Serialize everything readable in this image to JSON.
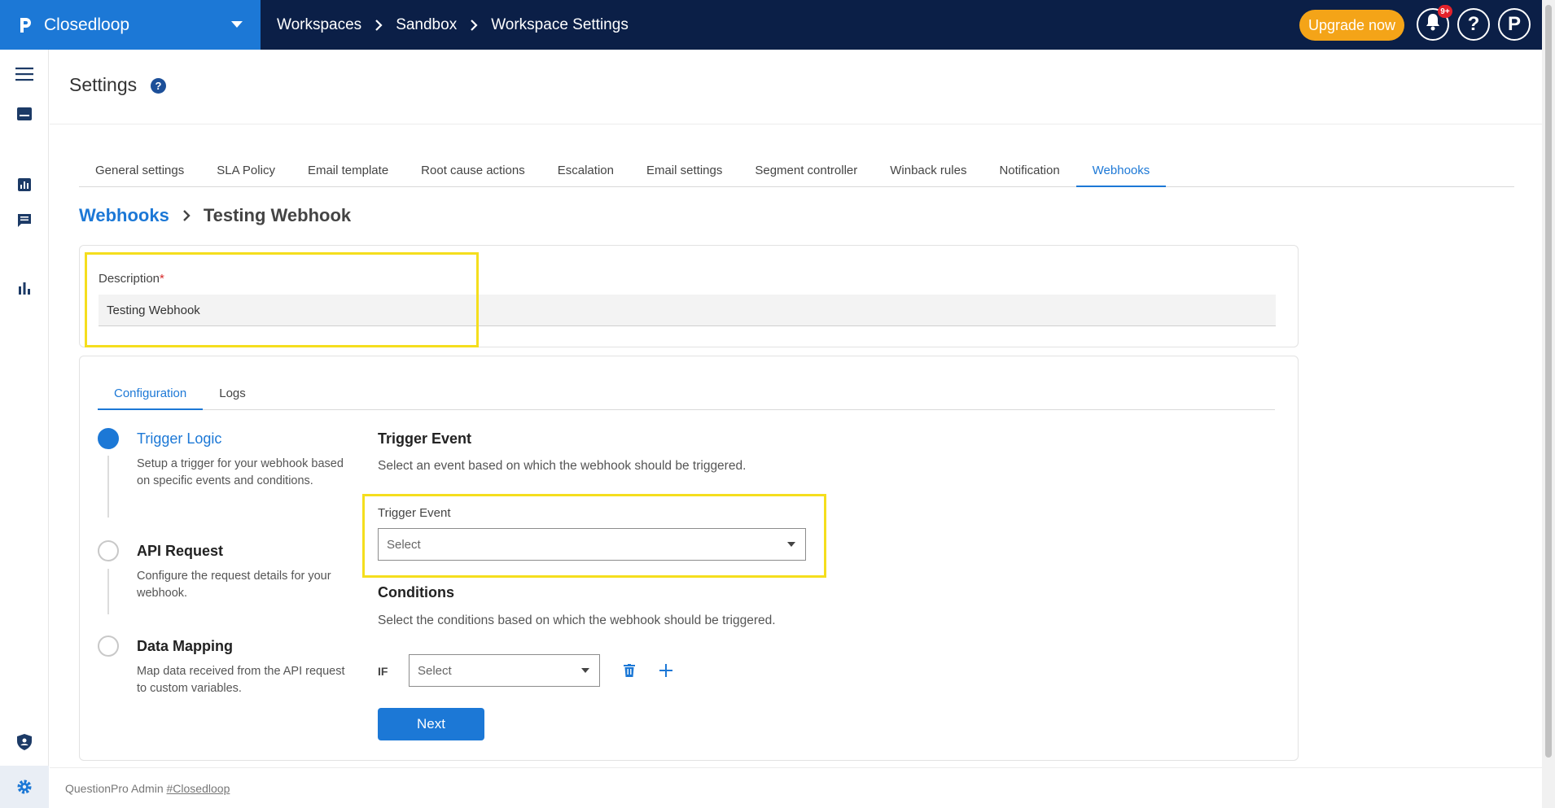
{
  "app": {
    "name": "Closedloop",
    "upgrade_label": "Upgrade now",
    "notification_badge": "9+",
    "help_glyph": "?",
    "profile_glyph": "P"
  },
  "breadcrumbs": [
    "Workspaces",
    "Sandbox",
    "Workspace Settings"
  ],
  "sidebar": {
    "icons": [
      "menu-icon",
      "inbox-icon",
      "analytics-icon",
      "chat-icon",
      "bar-chart-icon",
      "shield-user-icon",
      "settings-icon"
    ]
  },
  "page": {
    "title": "Settings",
    "help_glyph": "?"
  },
  "tabs": [
    {
      "label": "General settings",
      "active": false
    },
    {
      "label": "SLA Policy",
      "active": false
    },
    {
      "label": "Email template",
      "active": false
    },
    {
      "label": "Root cause actions",
      "active": false
    },
    {
      "label": "Escalation",
      "active": false
    },
    {
      "label": "Email settings",
      "active": false
    },
    {
      "label": "Segment controller",
      "active": false
    },
    {
      "label": "Winback rules",
      "active": false
    },
    {
      "label": "Notification",
      "active": false
    },
    {
      "label": "Webhooks",
      "active": true
    }
  ],
  "subcrumb": {
    "parent": "Webhooks",
    "current": "Testing Webhook"
  },
  "description": {
    "label": "Description",
    "required_mark": "*",
    "value": "Testing Webhook"
  },
  "inner_tabs": [
    {
      "label": "Configuration",
      "active": true
    },
    {
      "label": "Logs",
      "active": false
    }
  ],
  "steps": [
    {
      "title": "Trigger Logic",
      "desc": "Setup a trigger for your webhook based on specific events and conditions.",
      "active": true
    },
    {
      "title": "API Request",
      "desc": "Configure the request details for your webhook.",
      "active": false
    },
    {
      "title": "Data Mapping",
      "desc": "Map data received from the API request to custom variables.",
      "active": false
    }
  ],
  "trigger": {
    "heading": "Trigger Event",
    "subtitle": "Select an event based on which the webhook should be triggered.",
    "field_label": "Trigger Event",
    "placeholder": "Select"
  },
  "conditions": {
    "heading": "Conditions",
    "subtitle": "Select the conditions based on which the webhook should be triggered.",
    "if_label": "IF",
    "placeholder": "Select"
  },
  "next_label": "Next",
  "footer": {
    "prefix": "QuestionPro Admin",
    "link": "#Closedloop"
  },
  "colors": {
    "topbar": "#0b1f47",
    "brand": "#1c78d6",
    "accent": "#1c78d6",
    "upgrade": "#f4a418",
    "highlight": "#f5de1d"
  }
}
